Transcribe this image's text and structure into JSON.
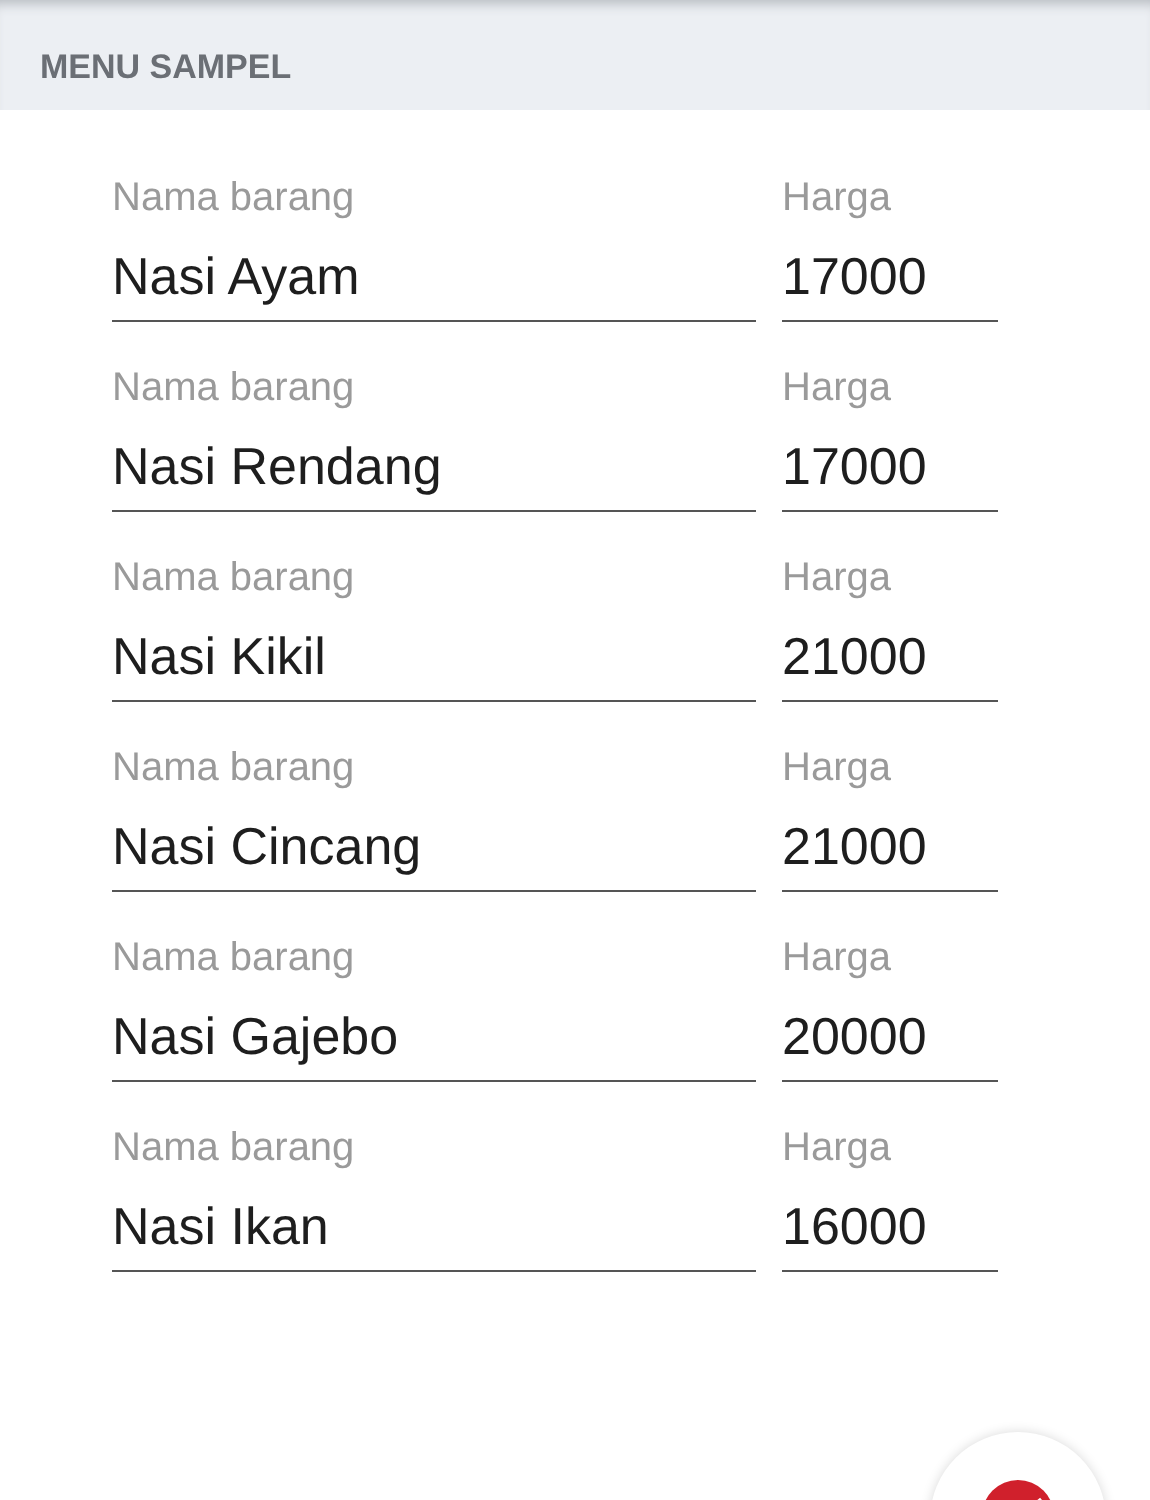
{
  "section_header": {
    "title": "MENU SAMPEL"
  },
  "items": [
    {
      "name_label": "Nama barang",
      "name": "Nasi Ayam",
      "price_label": "Harga",
      "price": "17000"
    },
    {
      "name_label": "Nama barang",
      "name": "Nasi Rendang",
      "price_label": "Harga",
      "price": "17000"
    },
    {
      "name_label": "Nama barang",
      "name": "Nasi Kikil",
      "price_label": "Harga",
      "price": "21000"
    },
    {
      "name_label": "Nama barang",
      "name": "Nasi Cincang",
      "price_label": "Harga",
      "price": "21000"
    },
    {
      "name_label": "Nama barang",
      "name": "Nasi Gajebo",
      "price_label": "Harga",
      "price": "20000"
    },
    {
      "name_label": "Nama barang",
      "name": "Nasi Ikan",
      "price_label": "Harga",
      "price": "16000"
    }
  ]
}
